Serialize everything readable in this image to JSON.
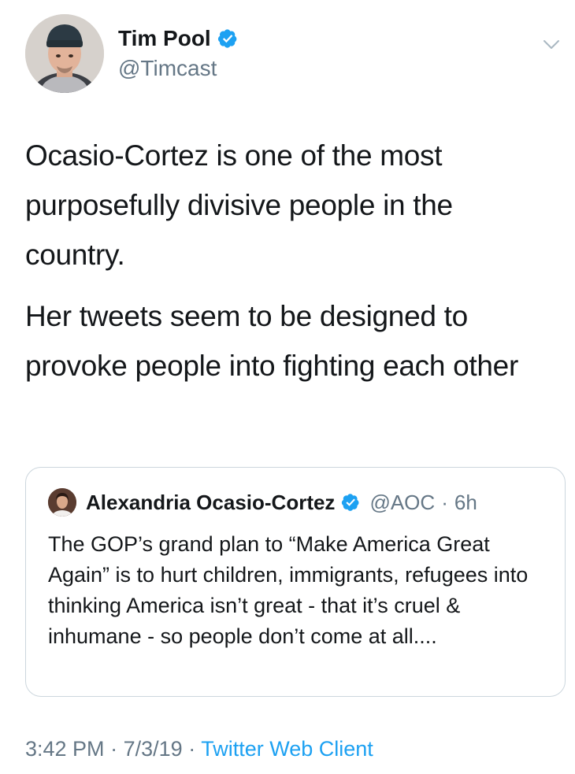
{
  "author": {
    "name": "Tim Pool",
    "handle": "@Timcast",
    "avatar_icon": "user-avatar-icon",
    "verified_color": "#1da1f2"
  },
  "tweet": {
    "paragraphs": [
      "Ocasio-Cortez is one of the most purposefully divisive people in the country.",
      "Her tweets seem to be designed to provoke people into fighting each other"
    ]
  },
  "quoted_tweet": {
    "name": "Alexandria Ocasio-Cortez",
    "handle": "@AOC",
    "separator": "·",
    "time": "6h",
    "text": "The GOP’s grand plan to “Make America Great Again” is to hurt children, immigrants, refugees into thinking America isn’t great - that it’s cruel & inhumane - so people don’t come at all...."
  },
  "footer": {
    "time": "3:42 PM",
    "separator1": "·",
    "date": "7/3/19",
    "separator2": "·",
    "client": "Twitter Web Client"
  },
  "colors": {
    "accent": "#1da1f2",
    "secondary_text": "#657786",
    "border": "#ccd6dd"
  }
}
